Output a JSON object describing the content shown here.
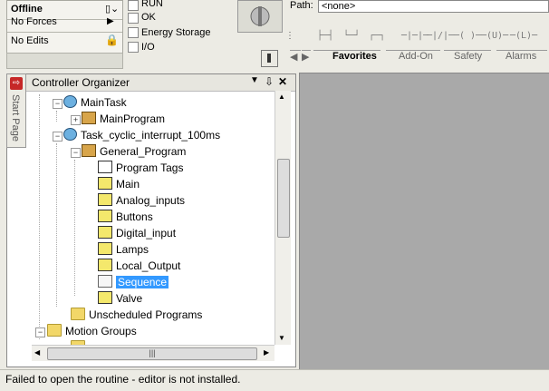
{
  "status": {
    "mode": "Offline",
    "forces": "No Forces",
    "edits": "No Edits",
    "checks": [
      "RUN",
      "OK",
      "Energy Storage",
      "I/O"
    ]
  },
  "path": {
    "label": "Path:",
    "value": "<none>"
  },
  "ladder_toolbar": [
    "├─┤",
    "└─┘",
    "┌─┐",
    "─|─|─",
    "─|/|─",
    "─( )─",
    "─(U)─",
    "─(L)─"
  ],
  "tabs": [
    "Favorites",
    "Add-On",
    "Safety",
    "Alarms"
  ],
  "organizer": {
    "title": "Controller Organizer",
    "ctrls": [
      "▼",
      "⇩",
      "✕"
    ],
    "start_page": "Start Page",
    "items": [
      "MainTask",
      "MainProgram",
      "Task_cyclic_interrupt_100ms",
      "General_Program",
      "Program Tags",
      "Main",
      "Analog_inputs",
      "Buttons",
      "Digital_input",
      "Lamps",
      "Local_Output",
      "Sequence",
      "Valve",
      "Unscheduled Programs",
      "Motion Groups"
    ]
  },
  "status_bar": "Failed to open the routine - editor is not installed."
}
